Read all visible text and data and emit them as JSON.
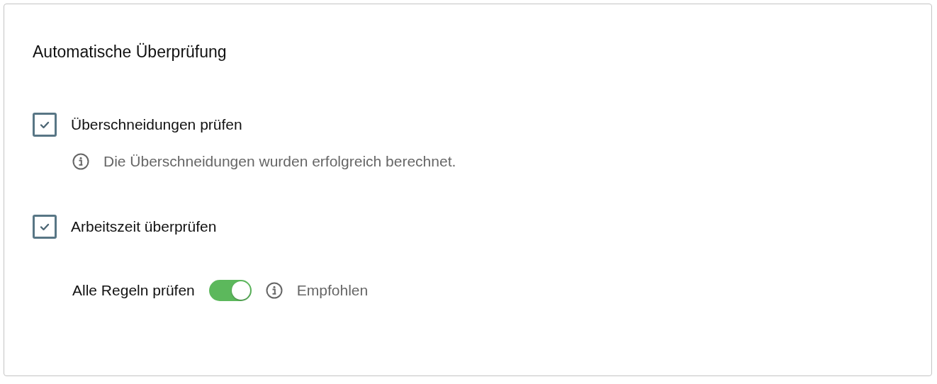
{
  "title": "Automatische Überprüfung",
  "options": [
    {
      "label": "Überschneidungen prüfen",
      "checked": true,
      "info": "Die Überschneidungen wurden erfolgreich berechnet."
    },
    {
      "label": "Arbeitszeit überprüfen",
      "checked": true,
      "setting": {
        "label": "Alle Regeln prüfen",
        "on": true,
        "hint": "Empfohlen"
      }
    }
  ]
}
